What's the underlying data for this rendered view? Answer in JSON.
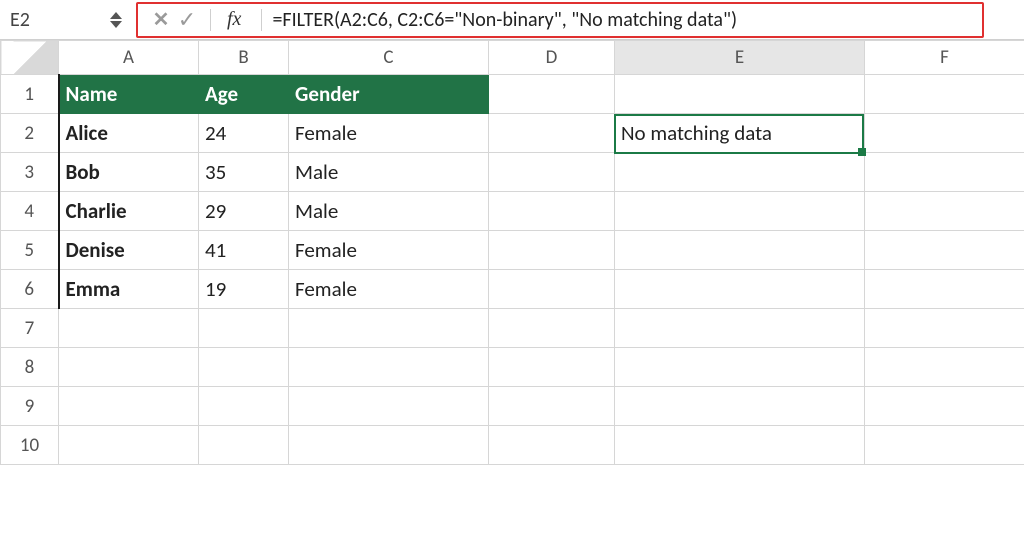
{
  "nameBox": {
    "value": "E2"
  },
  "formulaBar": {
    "formula": "=FILTER(A2:C6, C2:C6=\"Non-binary\", \"No matching data\")",
    "fxLabel": "fx"
  },
  "columns": [
    "A",
    "B",
    "C",
    "D",
    "E",
    "F"
  ],
  "rowHeaders": [
    "1",
    "2",
    "3",
    "4",
    "5",
    "6",
    "7",
    "8",
    "9",
    "10"
  ],
  "header": {
    "name": "Name",
    "age": "Age",
    "gender": "Gender"
  },
  "rows": [
    {
      "name": "Alice",
      "age": "24",
      "gender": "Female"
    },
    {
      "name": "Bob",
      "age": "35",
      "gender": "Male"
    },
    {
      "name": "Charlie",
      "age": "29",
      "gender": "Male"
    },
    {
      "name": "Denise",
      "age": "41",
      "gender": "Female"
    },
    {
      "name": "Emma",
      "age": "19",
      "gender": "Female"
    }
  ],
  "result": {
    "e2": "No matching data"
  },
  "activeCell": "E2",
  "colors": {
    "headerFill": "#217346",
    "selection": "#1b7a46",
    "highlightBox": "#e03030"
  }
}
